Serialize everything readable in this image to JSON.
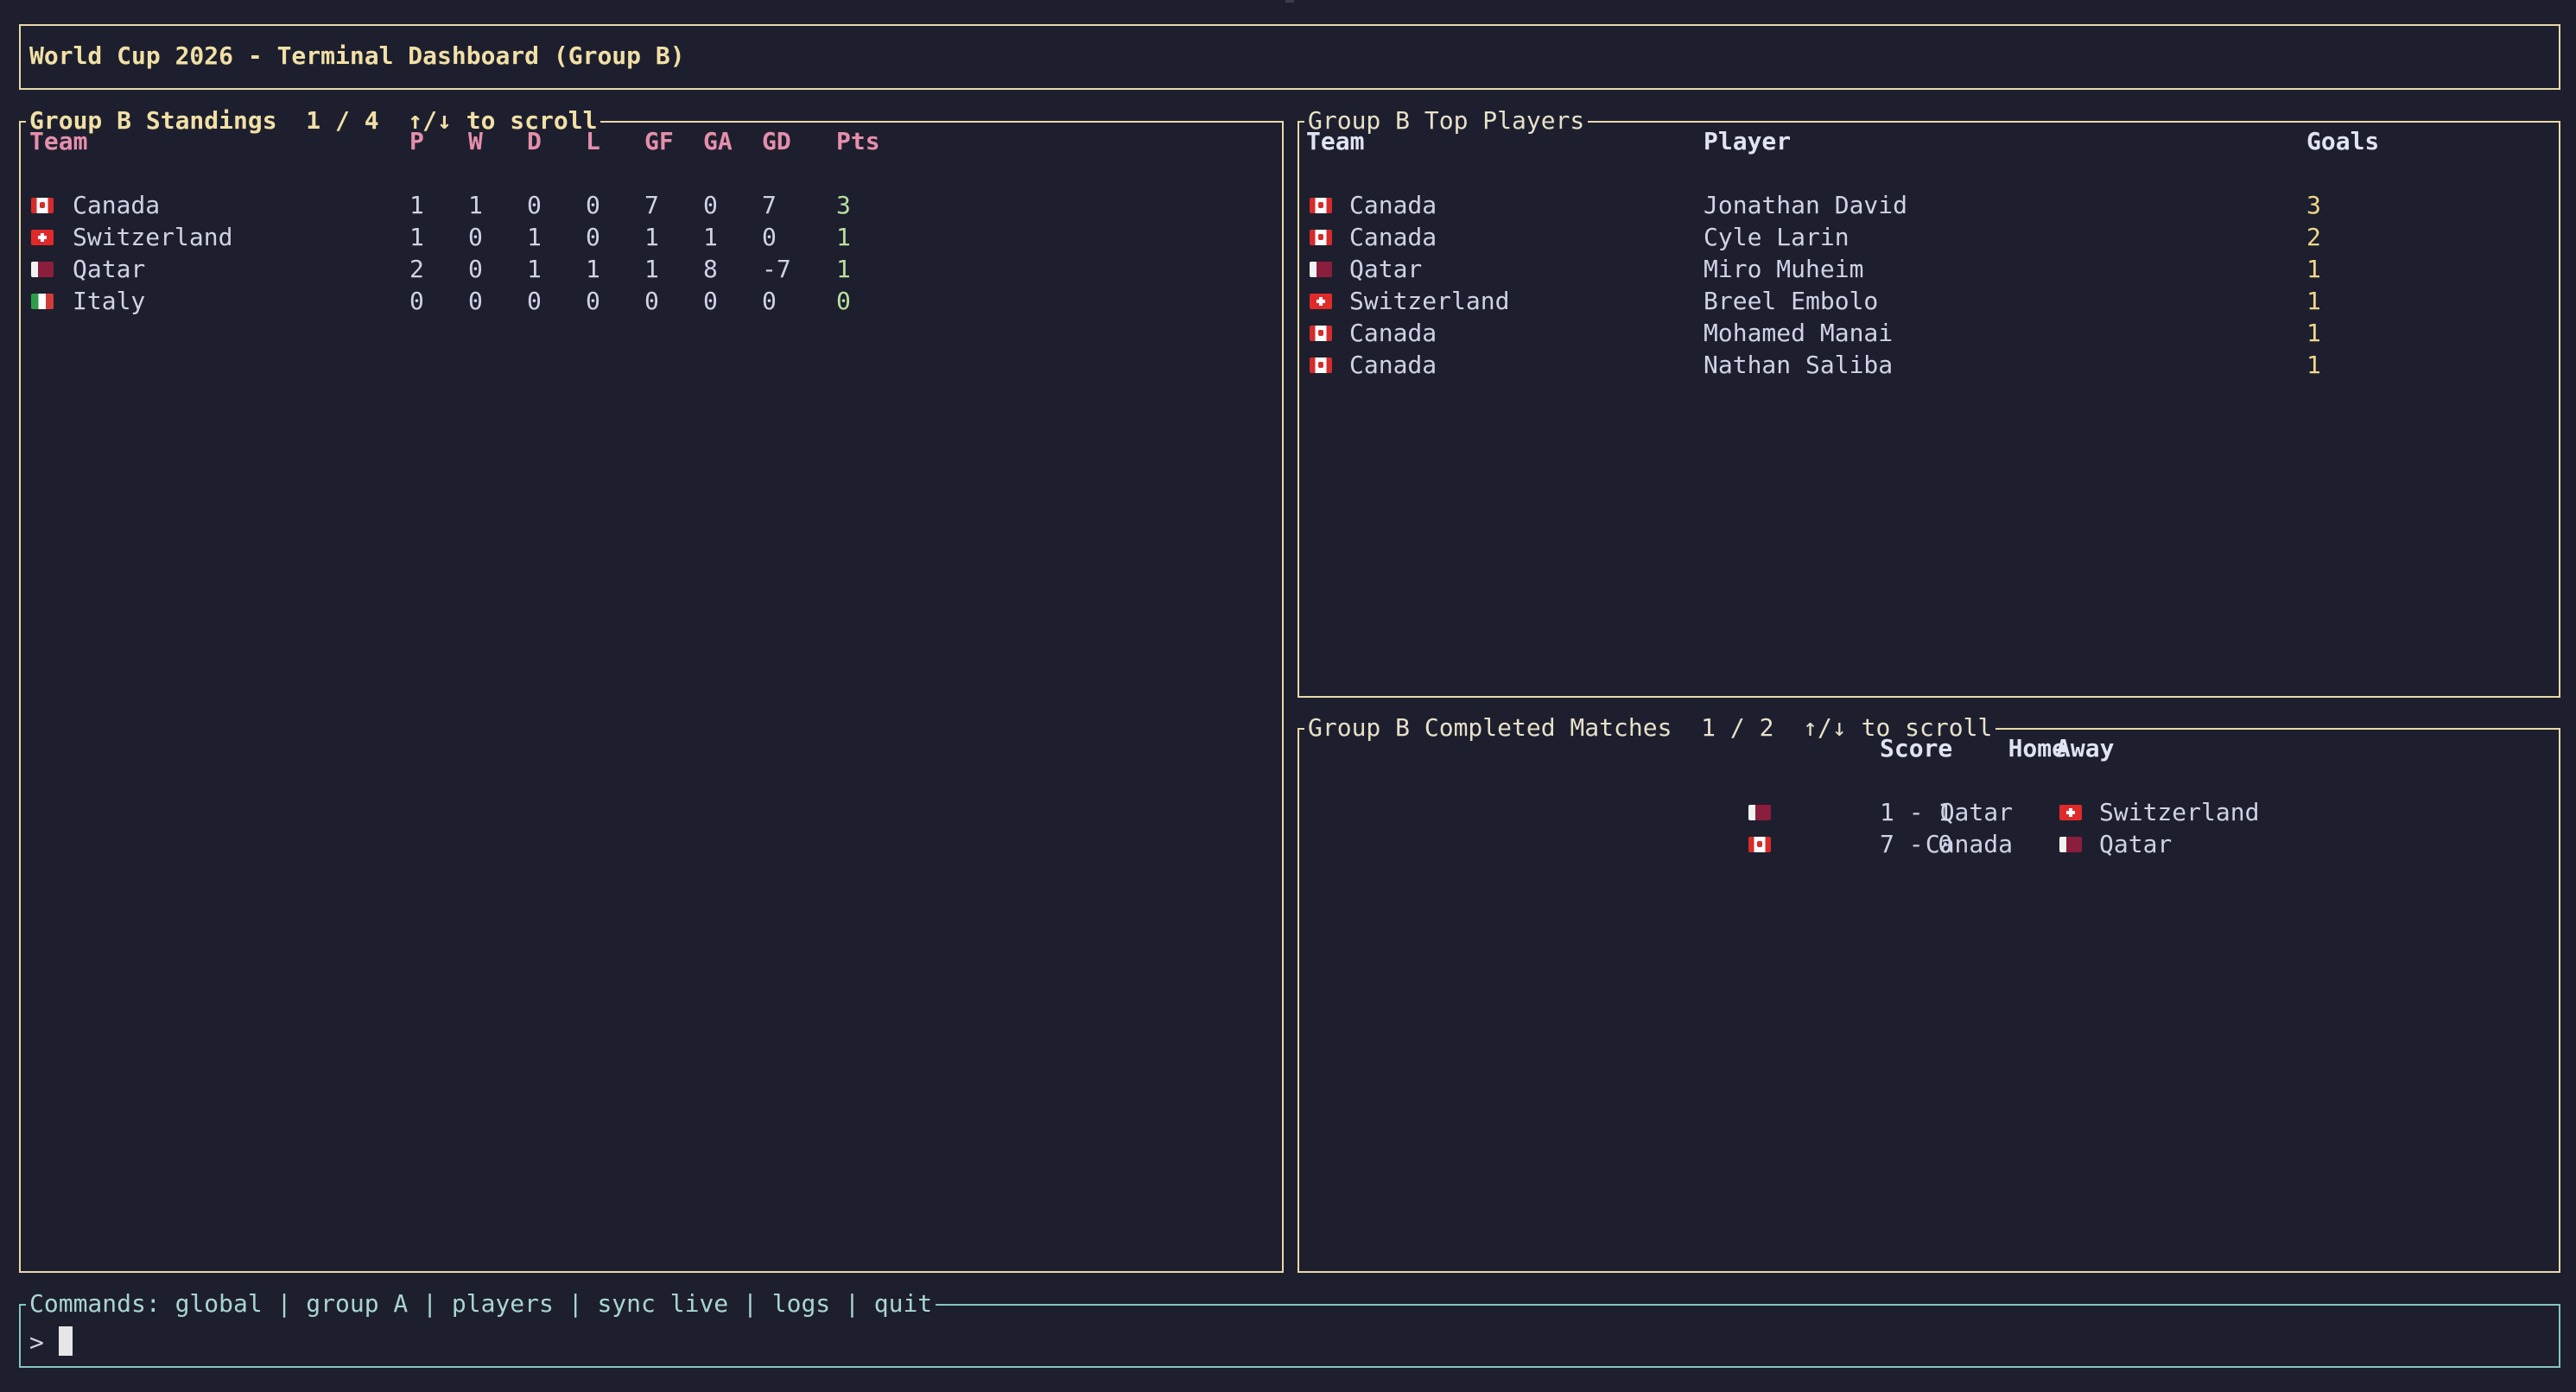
{
  "app_title": "World Cup 2026 - Terminal Dashboard (Group B)",
  "standings": {
    "title": "Group B Standings  1 / 4  ↑/↓ to scroll",
    "headers": [
      "Team",
      "P",
      "W",
      "D",
      "L",
      "GF",
      "GA",
      "GD",
      "Pts"
    ],
    "rows": [
      {
        "flag": "canada-flag-icon",
        "team": "Canada",
        "p": "1",
        "w": "1",
        "d": "0",
        "l": "0",
        "gf": "7",
        "ga": "0",
        "gd": "7",
        "pts": "3"
      },
      {
        "flag": "switzerland-flag-icon",
        "team": "Switzerland",
        "p": "1",
        "w": "0",
        "d": "1",
        "l": "0",
        "gf": "1",
        "ga": "1",
        "gd": "0",
        "pts": "1"
      },
      {
        "flag": "qatar-flag-icon",
        "team": "Qatar",
        "p": "2",
        "w": "0",
        "d": "1",
        "l": "1",
        "gf": "1",
        "ga": "8",
        "gd": "-7",
        "pts": "1"
      },
      {
        "flag": "italy-flag-icon",
        "team": "Italy",
        "p": "0",
        "w": "0",
        "d": "0",
        "l": "0",
        "gf": "0",
        "ga": "0",
        "gd": "0",
        "pts": "0"
      }
    ]
  },
  "players": {
    "title": "Group B Top Players",
    "headers": [
      "Team",
      "Player",
      "Goals"
    ],
    "rows": [
      {
        "flag": "canada-flag-icon",
        "team": "Canada",
        "player": "Jonathan David",
        "goals": "3"
      },
      {
        "flag": "canada-flag-icon",
        "team": "Canada",
        "player": "Cyle Larin",
        "goals": "2"
      },
      {
        "flag": "qatar-flag-icon",
        "team": "Qatar",
        "player": "Miro Muheim",
        "goals": "1"
      },
      {
        "flag": "switzerland-flag-icon",
        "team": "Switzerland",
        "player": "Breel Embolo",
        "goals": "1"
      },
      {
        "flag": "canada-flag-icon",
        "team": "Canada",
        "player": "Mohamed Manai",
        "goals": "1"
      },
      {
        "flag": "canada-flag-icon",
        "team": "Canada",
        "player": "Nathan Saliba",
        "goals": "1"
      }
    ]
  },
  "matches": {
    "title": "Group B Completed Matches  1 / 2  ↑/↓ to scroll",
    "headers": [
      "Home",
      "Score",
      "Away"
    ],
    "rows": [
      {
        "home": "Qatar",
        "home_flag": "qatar-flag-icon",
        "score": "1 - 1",
        "away_flag": "switzerland-flag-icon",
        "away": "Switzerland"
      },
      {
        "home": "Canada",
        "home_flag": "canada-flag-icon",
        "score": "7 - 0",
        "away_flag": "qatar-flag-icon",
        "away": "Qatar"
      }
    ]
  },
  "commands": {
    "title": "Commands: global | group A | players | sync live | logs | quit",
    "prompt": ">"
  },
  "colors": {
    "background": "#1e1f2e",
    "border_yellow": "#e8d9a8",
    "border_teal": "#86c5c1",
    "header_pink": "#e58fac",
    "pts_green": "#b7e0a0",
    "goals_yellow": "#f0d889"
  }
}
